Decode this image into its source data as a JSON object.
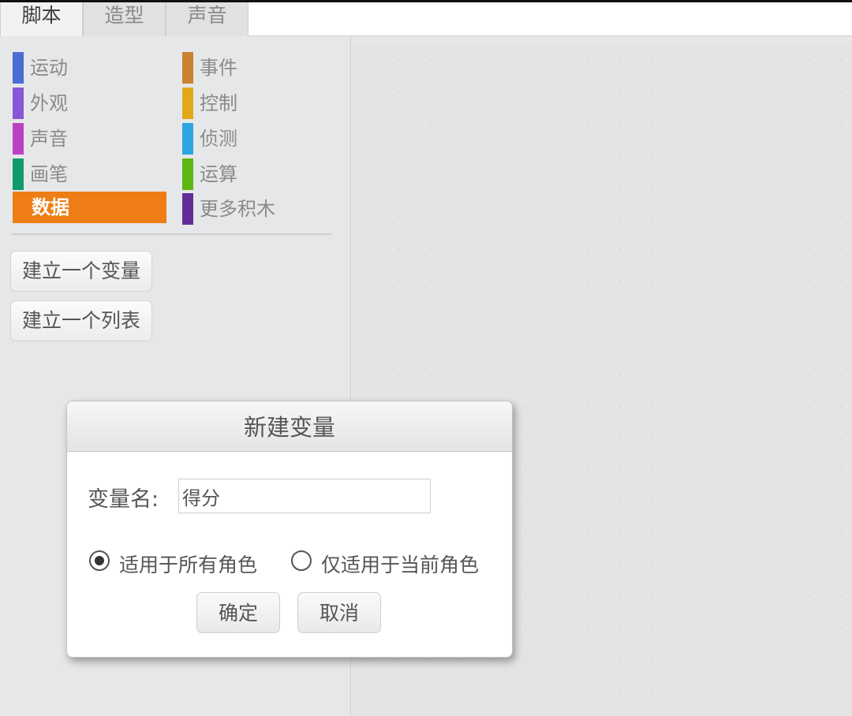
{
  "tabs": [
    {
      "label": "脚本",
      "active": true
    },
    {
      "label": "造型",
      "active": false
    },
    {
      "label": "声音",
      "active": false
    }
  ],
  "categories": [
    {
      "label": "运动",
      "color": "#4a6cd4"
    },
    {
      "label": "外观",
      "color": "#8a55d7"
    },
    {
      "label": "声音",
      "color": "#bb42c3"
    },
    {
      "label": "画笔",
      "color": "#0e9a6c"
    },
    {
      "label": "数据",
      "color": "#ee7d16",
      "selected": true
    },
    {
      "label": "事件",
      "color": "#c88330"
    },
    {
      "label": "控制",
      "color": "#e1a91a"
    },
    {
      "label": "侦测",
      "color": "#2ca5e2"
    },
    {
      "label": "运算",
      "color": "#5cb712"
    },
    {
      "label": "更多积木",
      "color": "#632d99"
    }
  ],
  "palette_buttons": {
    "make_variable": "建立一个变量",
    "make_list": "建立一个列表"
  },
  "dialog": {
    "title": "新建变量",
    "name_label": "变量名:",
    "name_value": "得分",
    "radio_all": "适用于所有角色",
    "radio_this": "仅适用于当前角色",
    "selected_scope": "all",
    "ok": "确定",
    "cancel": "取消"
  }
}
